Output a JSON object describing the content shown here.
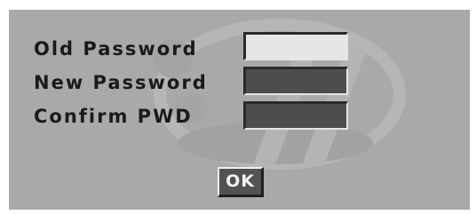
{
  "dialog": {
    "fields": {
      "old_password": {
        "label": "Old Password",
        "value": ""
      },
      "new_password": {
        "label": "New Password",
        "value": ""
      },
      "confirm_password": {
        "label": "Confirm PWD",
        "value": ""
      }
    },
    "ok_label": "OK"
  },
  "colors": {
    "panel_background": "#a9a9a9",
    "active_field": "#e6e6e6",
    "inactive_field": "#4d4d4d",
    "button_background": "#525252",
    "label_text": "#1a1a1a"
  }
}
